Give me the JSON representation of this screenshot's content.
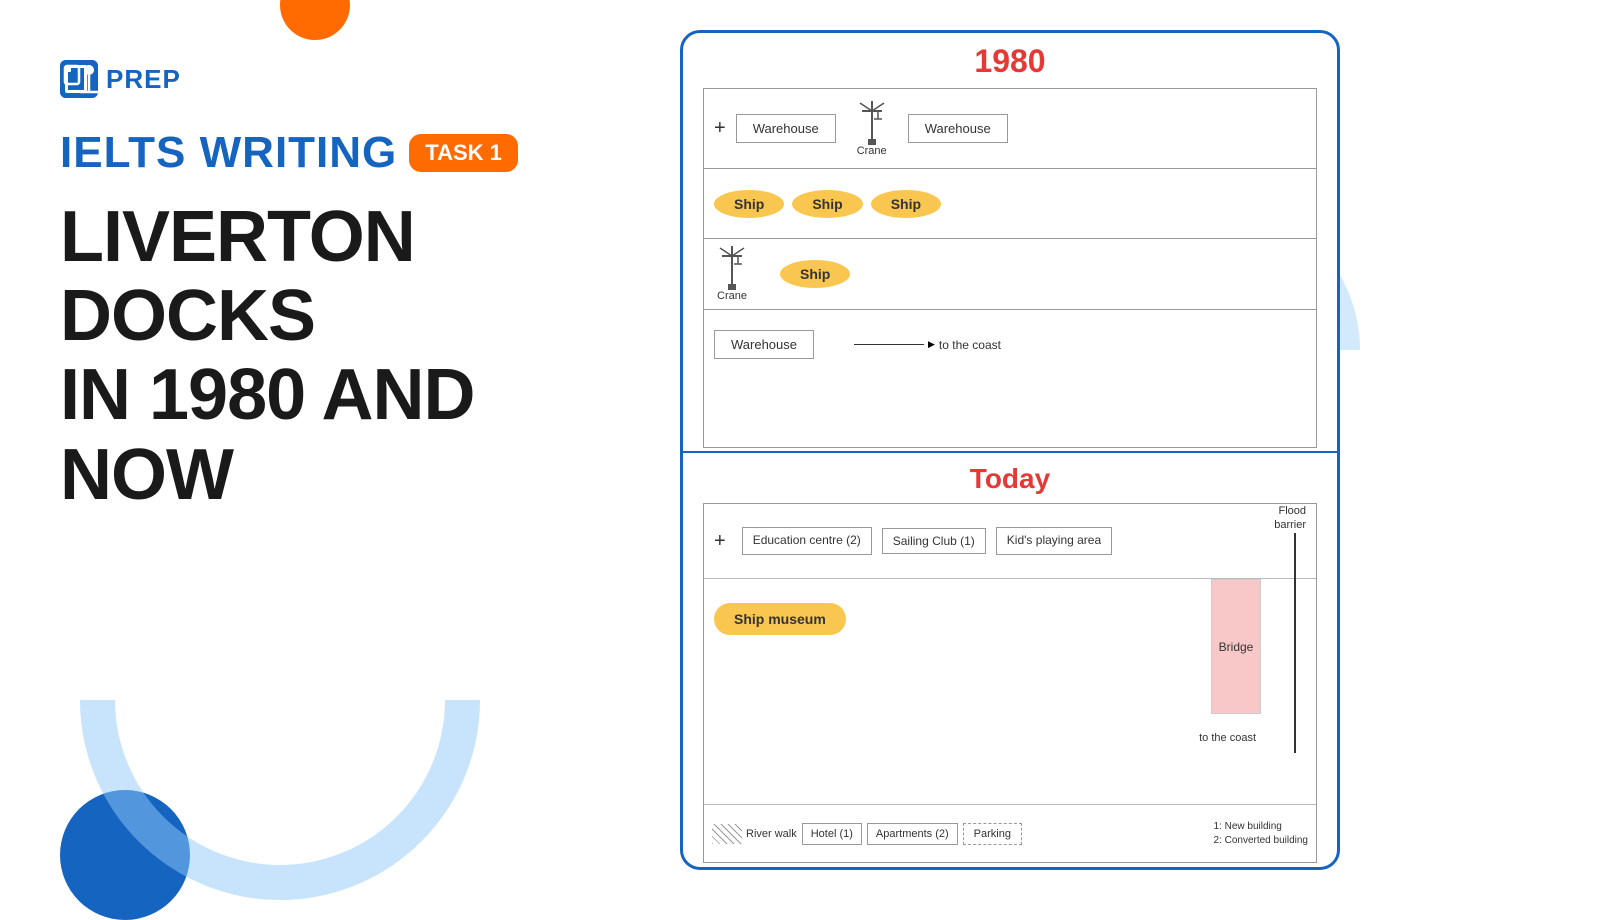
{
  "logo": {
    "text": "PREP"
  },
  "header": {
    "ielts_writing": "IELTS WRITING",
    "task_badge": "TASK 1",
    "title_line1": "LIVERTON DOCKS",
    "title_line2": "IN 1980 AND NOW"
  },
  "diagram": {
    "section_1980_title": "1980",
    "section_today_title": "Today",
    "row1_warehouse_left": "Warehouse",
    "row1_crane_label": "Crane",
    "row1_warehouse_right": "Warehouse",
    "ship1": "Ship",
    "ship2": "Ship",
    "ship3": "Ship",
    "ship4": "Ship",
    "crane2_label": "Crane",
    "warehouse_mid": "Warehouse",
    "to_coast": "to the coast",
    "education_centre": "Education centre (2)",
    "sailing_club": "Sailing Club (1)",
    "kids_playing": "Kid's playing area",
    "flood_barrier": "Flood barrier",
    "ship_museum": "Ship museum",
    "bridge": "Bridge",
    "to_coast_today": "to the coast",
    "river_walk": "River walk",
    "hotel": "Hotel (1)",
    "apartments": "Apartments (2)",
    "parking": "Parking",
    "legend_1": "1: New building",
    "legend_2": "2: Converted building"
  }
}
